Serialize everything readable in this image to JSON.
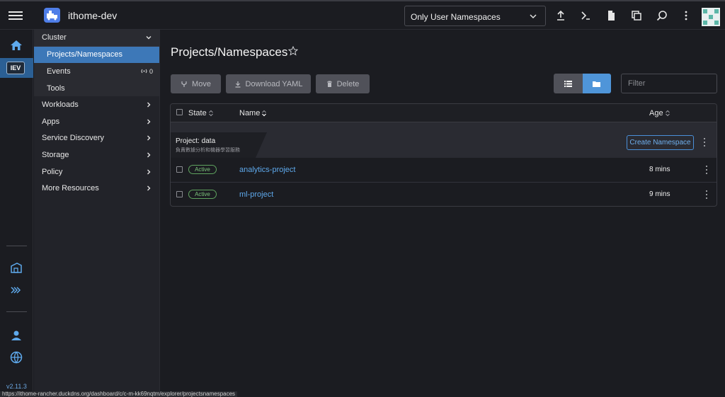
{
  "header": {
    "cluster_name": "ithome-dev",
    "namespace_filter": "Only User Namespaces",
    "icons": [
      "upload-icon",
      "terminal-icon",
      "file-icon",
      "copy-icon",
      "search-icon",
      "more-icon"
    ]
  },
  "rail": {
    "cluster_abbrev": "IEV",
    "version": "v2.11.3"
  },
  "sidenav": {
    "cluster_label": "Cluster",
    "cluster_items": [
      {
        "label": "Projects/Namespaces",
        "active": true
      },
      {
        "label": "Events",
        "count": "0"
      },
      {
        "label": "Tools"
      }
    ],
    "groups": [
      {
        "label": "Workloads"
      },
      {
        "label": "Apps"
      },
      {
        "label": "Service Discovery"
      },
      {
        "label": "Storage"
      },
      {
        "label": "Policy"
      },
      {
        "label": "More Resources"
      }
    ]
  },
  "main": {
    "title": "Projects/Namespaces",
    "buttons": {
      "move": "Move",
      "download": "Download YAML",
      "delete": "Delete"
    },
    "filter_placeholder": "Filter",
    "columns": {
      "state": "State",
      "name": "Name",
      "age": "Age"
    },
    "project": {
      "title": "Project:  data",
      "description": "負責數據分析和機器學習服務",
      "create_label": "Create Namespace"
    },
    "rows": [
      {
        "state": "Active",
        "name": "analytics-project",
        "age": "8 mins"
      },
      {
        "state": "Active",
        "name": "ml-project",
        "age": "9 mins"
      }
    ]
  },
  "status_url": "https://ithome-rancher.duckdns.org/dashboard/c/c-m-kk69nqtm/explorer/projectsnamespaces",
  "colors": {
    "accent": "#3d78b8",
    "link": "#5ea9ec",
    "active_badge": "#7cc47c",
    "background": "#1b1c21"
  }
}
